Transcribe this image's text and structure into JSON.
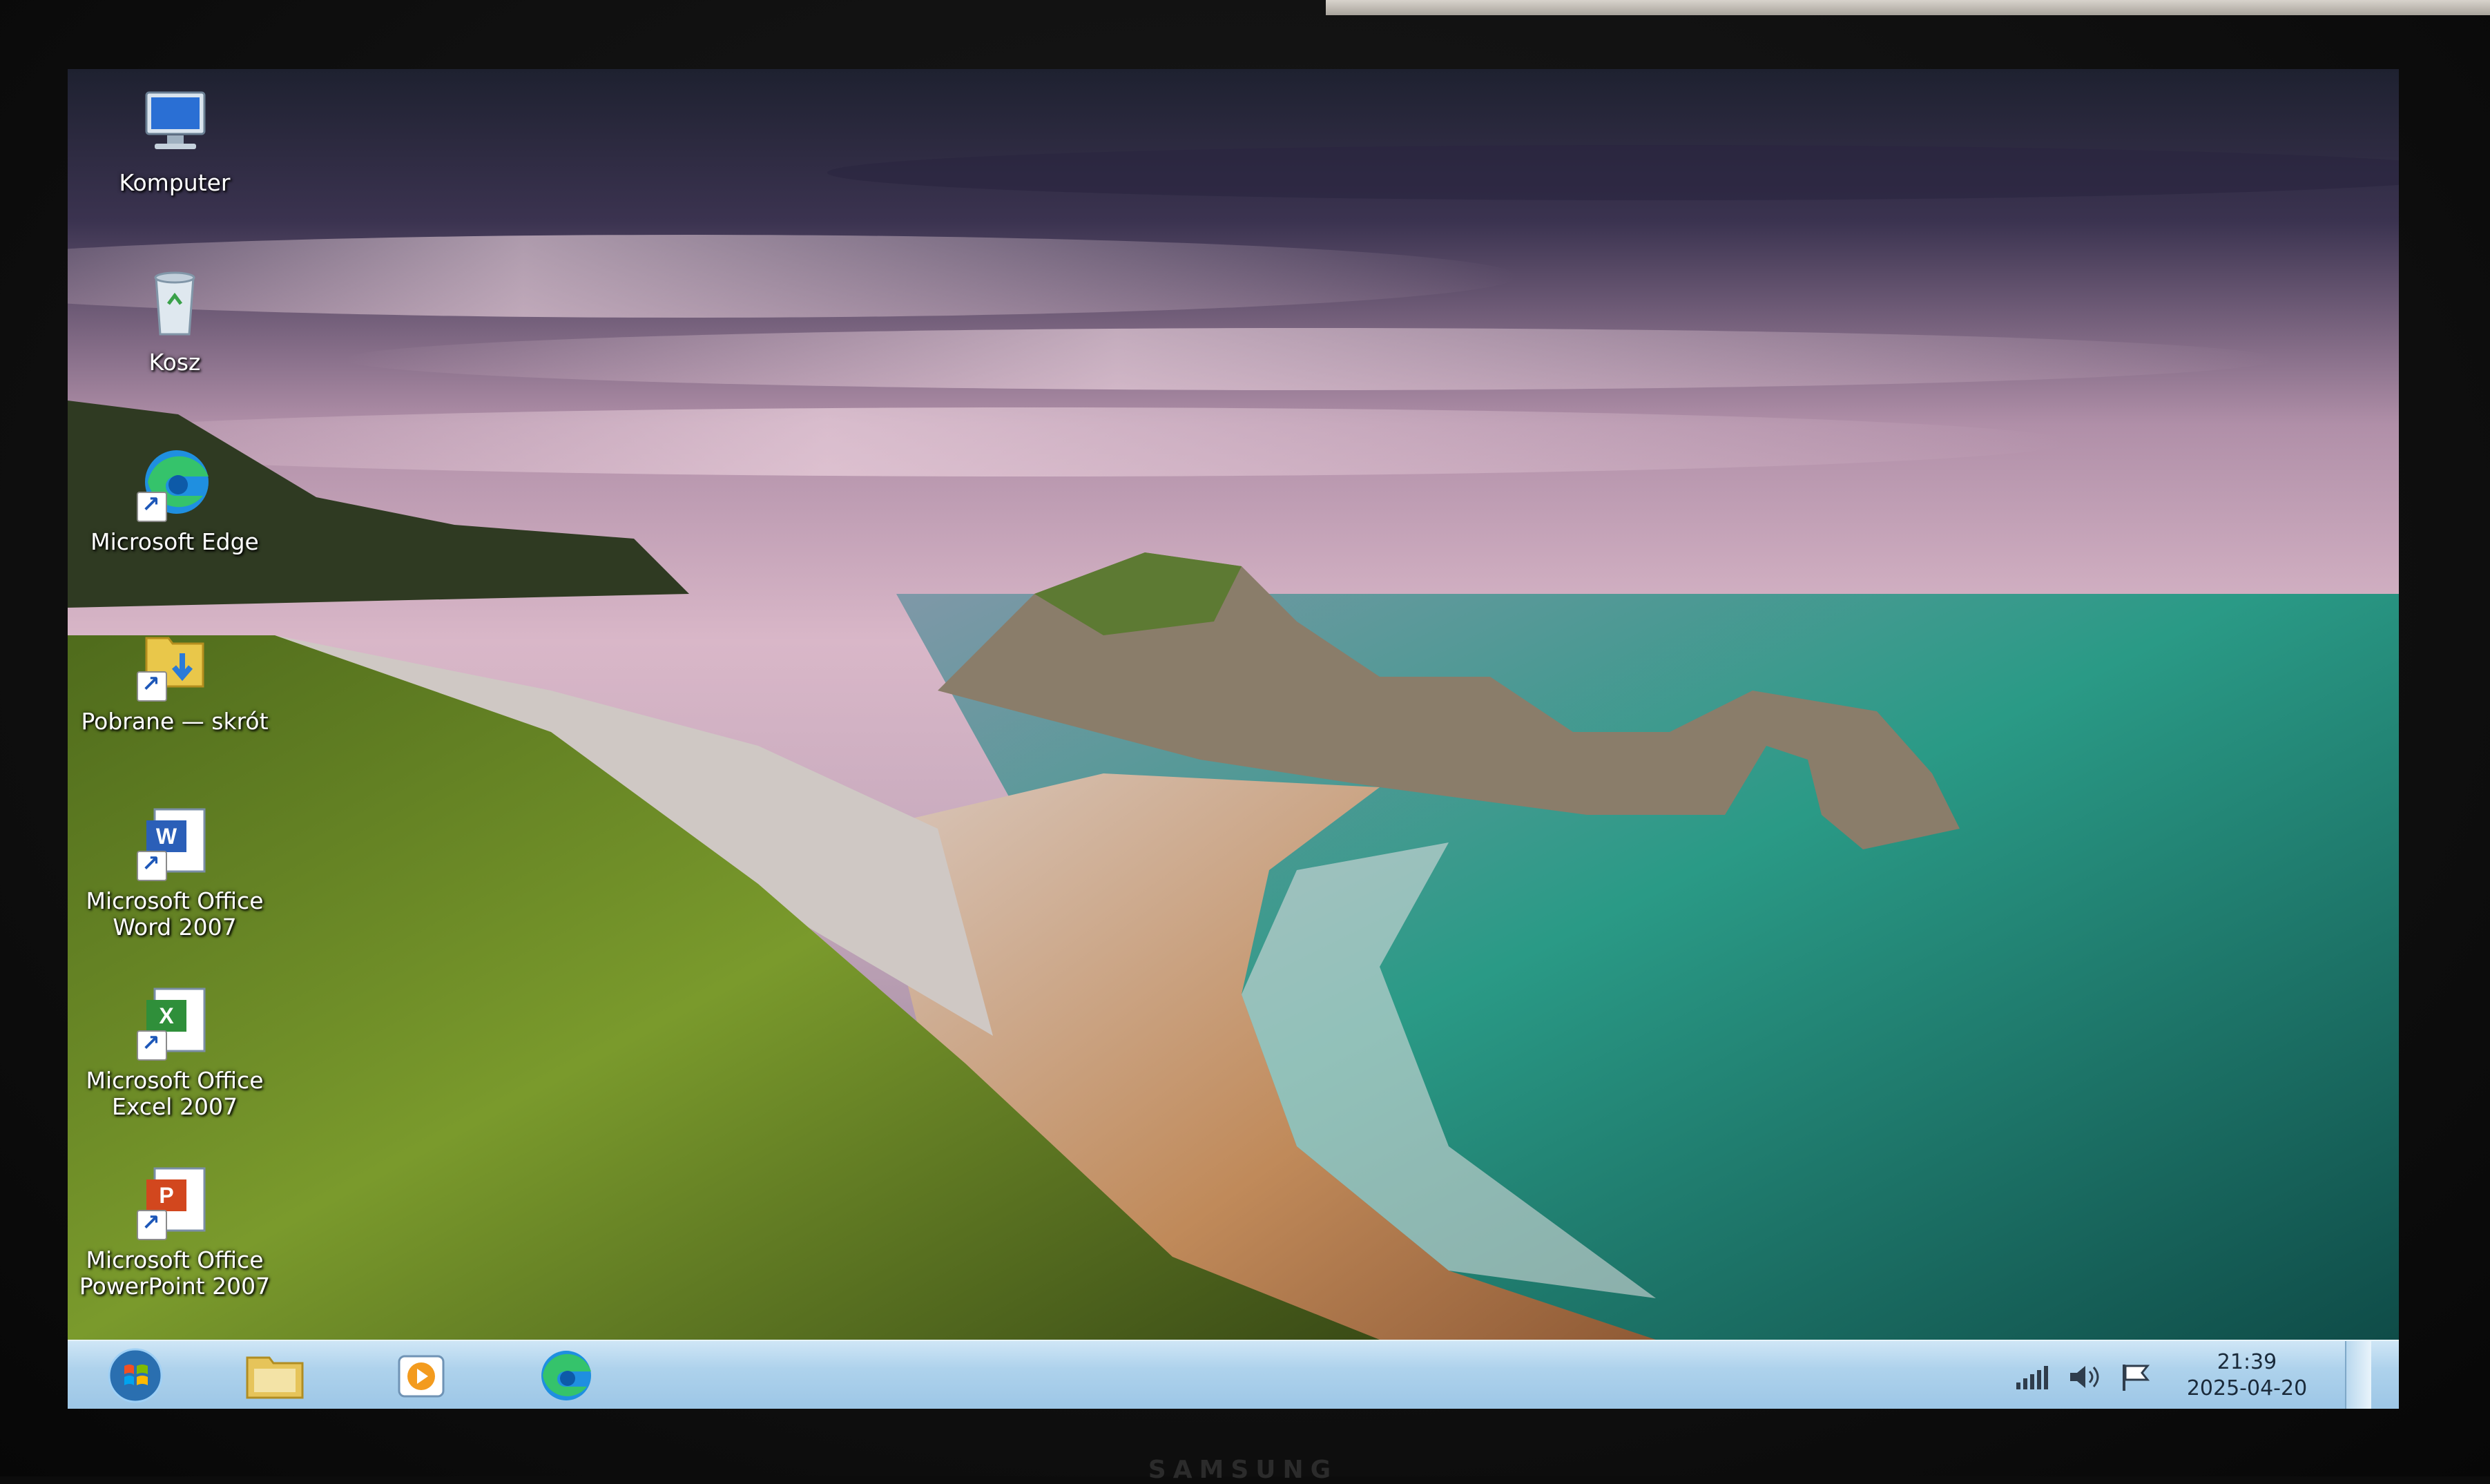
{
  "desktop": {
    "icons": [
      {
        "label": "Komputer",
        "icon": "computer-icon"
      },
      {
        "label": "Kosz",
        "icon": "recycle-bin-icon"
      },
      {
        "label": "Microsoft Edge",
        "icon": "edge-icon"
      },
      {
        "label": "Pobrane — skrót",
        "icon": "downloads-folder-icon"
      },
      {
        "label": "Microsoft Office\nWord 2007",
        "icon": "word-icon"
      },
      {
        "label": "Microsoft Office\nExcel 2007",
        "icon": "excel-icon"
      },
      {
        "label": "Microsoft Office\nPowerPoint 2007",
        "icon": "powerpoint-icon"
      }
    ]
  },
  "taskbar": {
    "start_icon": "windows-start-icon",
    "pinned": [
      {
        "name": "Windows Explorer",
        "icon": "explorer-folder-icon"
      },
      {
        "name": "Windows Media Player",
        "icon": "media-player-icon"
      },
      {
        "name": "Microsoft Edge",
        "icon": "edge-icon"
      }
    ],
    "tray": {
      "icons": [
        "network-signal-icon",
        "volume-icon",
        "action-center-flag-icon"
      ],
      "time": "21:39",
      "date": "2025-04-20"
    }
  },
  "monitor": {
    "brand": "SAMSUNG"
  },
  "colors": {
    "taskbar_top": "#cfe6f6",
    "taskbar_bottom": "#9cc6e6",
    "sea": "#1f8a78",
    "sky": "#c9a6bf",
    "grass": "#6f8f2a"
  }
}
